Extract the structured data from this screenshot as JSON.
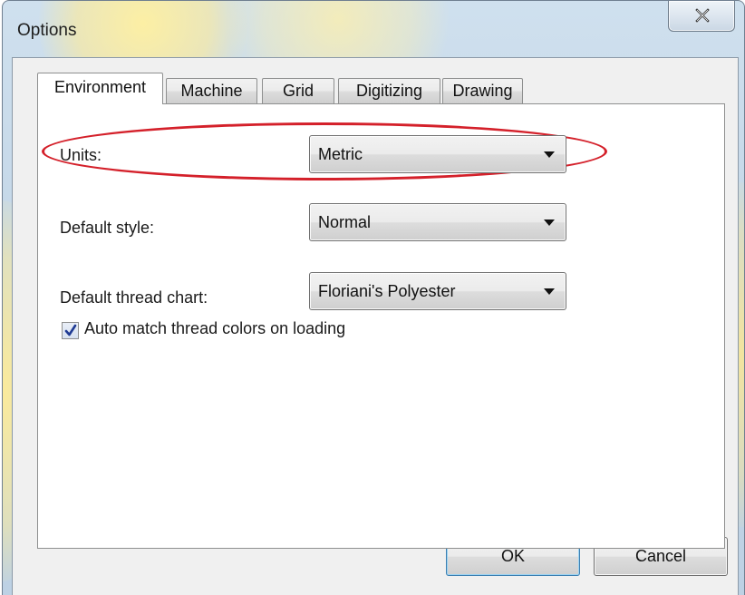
{
  "window": {
    "title": "Options",
    "close_icon": "close-icon"
  },
  "tabs": [
    {
      "label": "Environment",
      "active": true
    },
    {
      "label": "Machine",
      "active": false
    },
    {
      "label": "Grid",
      "active": false
    },
    {
      "label": "Digitizing",
      "active": false
    },
    {
      "label": "Drawing",
      "active": false
    }
  ],
  "environment": {
    "units": {
      "label": "Units:",
      "value": "Metric"
    },
    "default_style": {
      "label": "Default style:",
      "value": "Normal"
    },
    "default_thread_chart": {
      "label": "Default thread chart:",
      "value": "Floriani's Polyester"
    },
    "auto_match": {
      "label": "Auto match thread colors on loading",
      "checked": true
    }
  },
  "buttons": {
    "ok": "OK",
    "cancel": "Cancel"
  },
  "colors": {
    "highlight": "#d4202a",
    "checkmark": "#1f3a93"
  }
}
